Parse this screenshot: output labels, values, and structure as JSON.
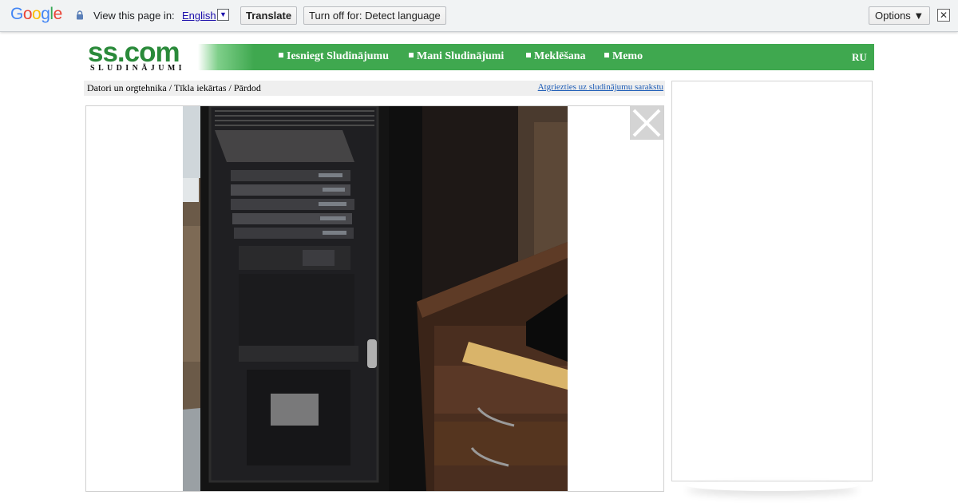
{
  "translate_bar": {
    "logo_letters": [
      "G",
      "o",
      "o",
      "g",
      "l",
      "e"
    ],
    "logo_colors": [
      "#4285f4",
      "#ea4335",
      "#fbbc05",
      "#4285f4",
      "#34a853",
      "#ea4335"
    ],
    "label": "View this page in:",
    "language": "English",
    "language_arrow": "▼",
    "translate_button": "Translate",
    "turn_off_button": "Turn off for: Detect language",
    "options_button": "Options ▼",
    "close_glyph": "✕"
  },
  "site": {
    "logo_main": "ss.com",
    "logo_sub": "SLUDINĀJUMI",
    "brand_color": "#3fa84f",
    "nav": [
      {
        "label": "Iesniegt Sludinājumu"
      },
      {
        "label": "Mani Sludinājumi"
      },
      {
        "label": "Meklēšana"
      },
      {
        "label": "Memo"
      }
    ],
    "lang_switch": "RU"
  },
  "breadcrumb": {
    "path": "Datori un orgtehnika / Tīkla iekārtas / Pārdod",
    "back_link": "Atgriezties uz sludinājumu sarakstu"
  },
  "photo": {
    "subject": "server-rack-cabinet-photo",
    "close_icon": "close-icon"
  }
}
